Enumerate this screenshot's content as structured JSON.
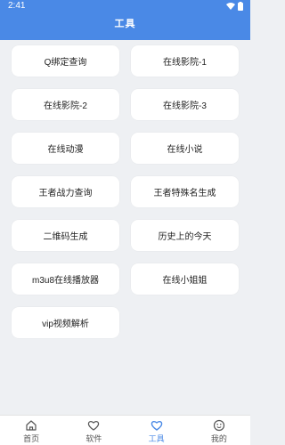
{
  "status_bar": {
    "time": "2:41"
  },
  "header": {
    "title": "工具"
  },
  "tools": [
    "Q绑定查询",
    "在线影院-1",
    "在线影院-2",
    "在线影院-3",
    "在线动漫",
    "在线小说",
    "王者战力查询",
    "王者特殊名生成",
    "二维码生成",
    "历史上的今天",
    "m3u8在线播放器",
    "在线小姐姐",
    "vip视频解析"
  ],
  "bottom_nav": [
    {
      "label": "首页",
      "icon": "home-icon"
    },
    {
      "label": "软件",
      "icon": "heart-icon"
    },
    {
      "label": "工具",
      "icon": "heart-icon",
      "active": true
    },
    {
      "label": "我的",
      "icon": "smile-icon"
    }
  ],
  "colors": {
    "accent": "#4a89e6",
    "background": "#eef0f3"
  }
}
